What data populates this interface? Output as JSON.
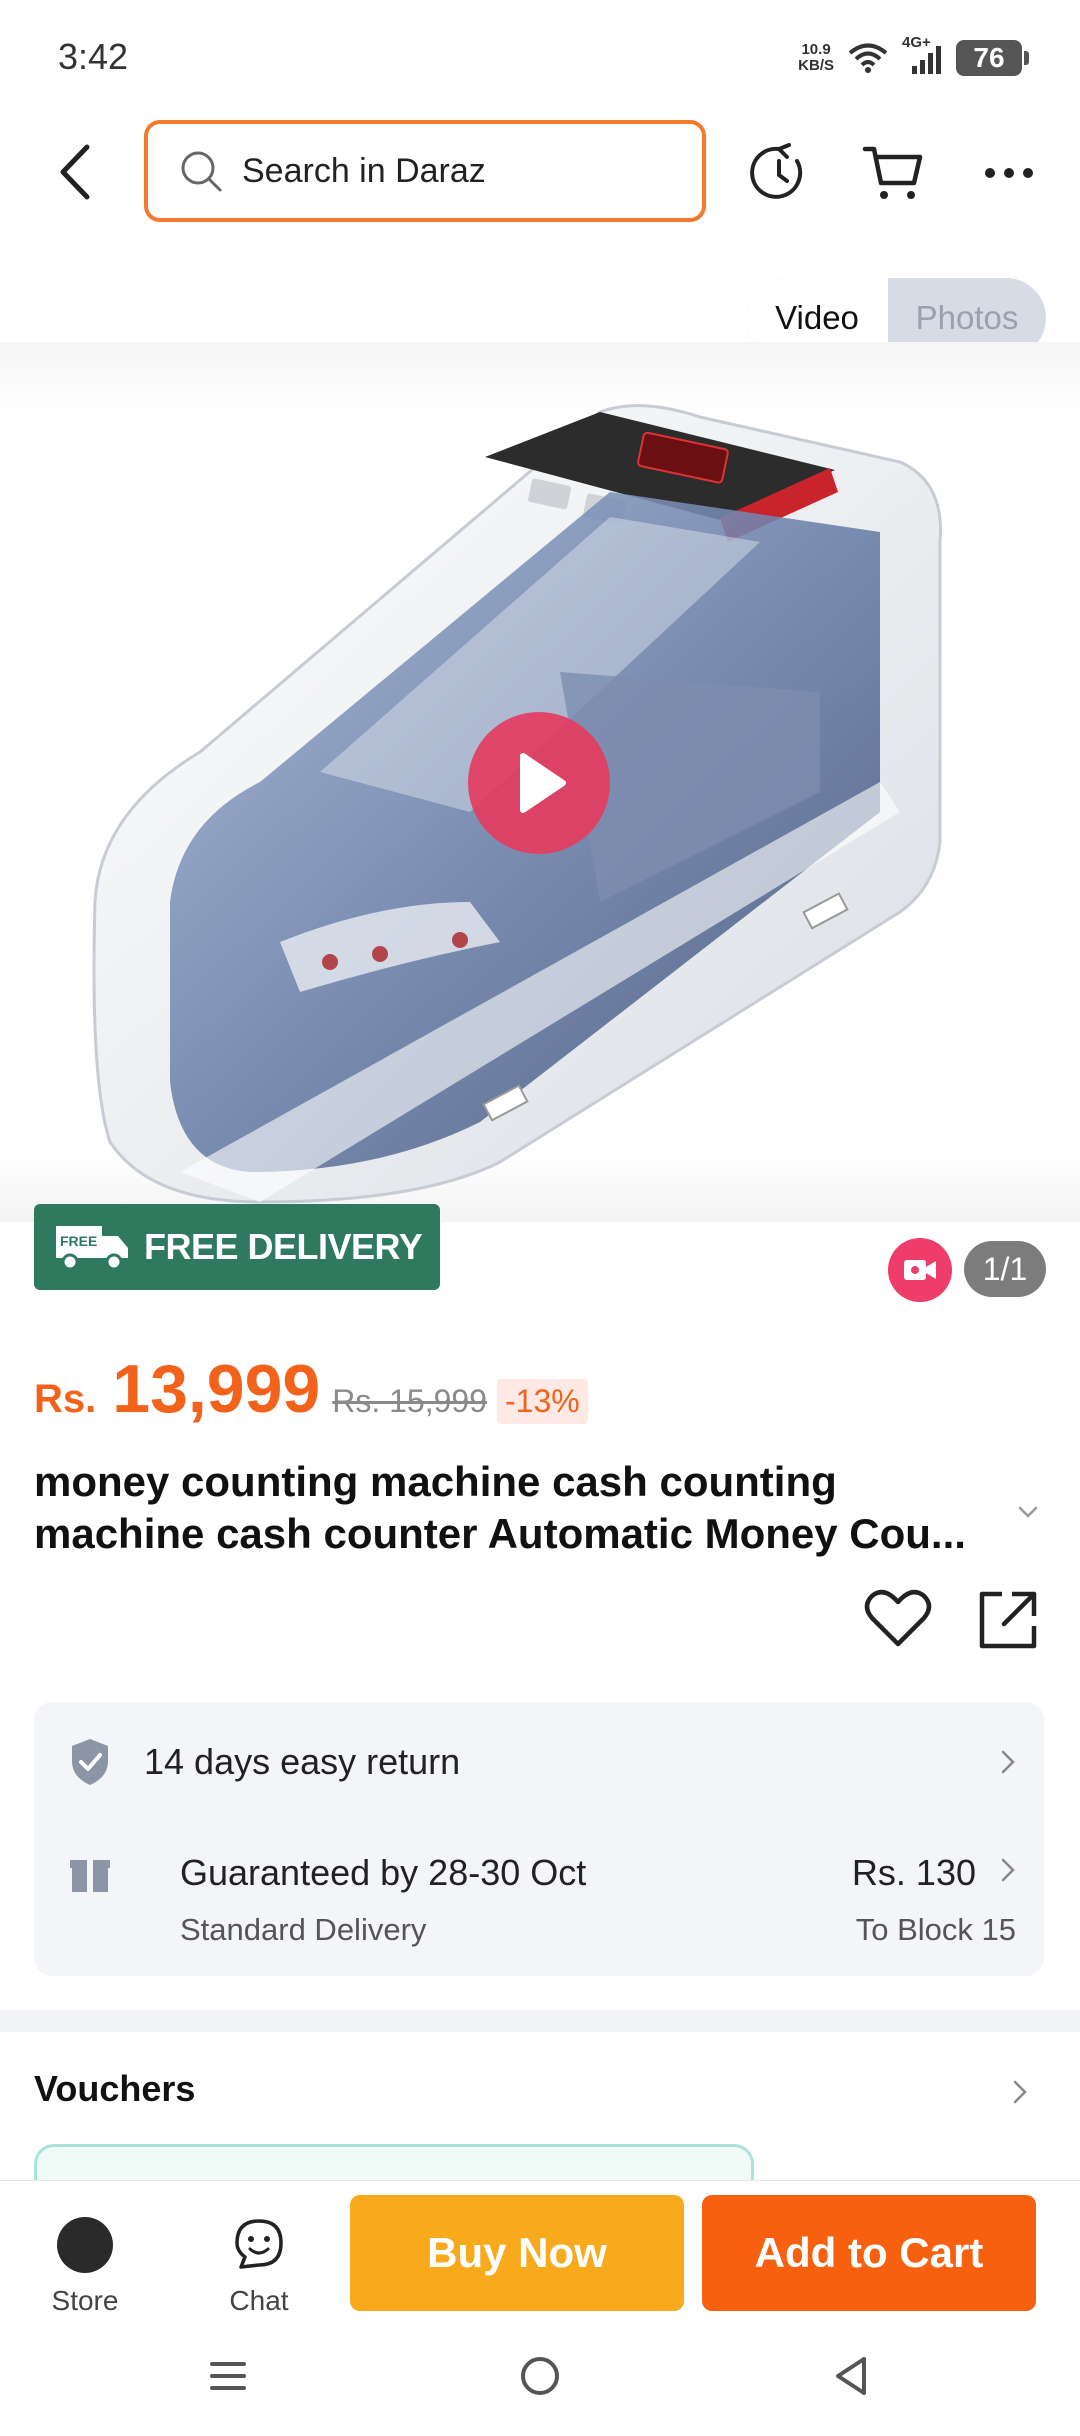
{
  "status_bar": {
    "time": "3:42",
    "net_speed_value": "10.9",
    "net_speed_unit": "KB/S",
    "network": "4G+",
    "battery": "76"
  },
  "header": {
    "search_placeholder": "Search in Daraz"
  },
  "media_toggle": {
    "video": "Video",
    "photos": "Photos",
    "active": "Video"
  },
  "gallery": {
    "badge_label": "FREE DELIVERY",
    "badge_tag": "FREE",
    "counter": "1/1"
  },
  "product": {
    "currency": "Rs.",
    "price": "13,999",
    "old_price": "Rs. 15,999",
    "discount": "-13%",
    "title_line1": "money counting machine cash counting",
    "title_line2": "machine cash counter Automatic Money Cou..."
  },
  "delivery": {
    "return_policy": "14 days easy return",
    "guarantee": "Guaranteed by 28-30 Oct",
    "method": "Standard Delivery",
    "fee": "Rs. 130",
    "destination": "To Block 15"
  },
  "vouchers": {
    "title": "Vouchers"
  },
  "action_bar": {
    "store_label": "Store",
    "chat_label": "Chat",
    "buy_now": "Buy Now",
    "add_to_cart": "Add to Cart"
  },
  "colors": {
    "brand_orange": "#f6600f",
    "buy_yellow": "#f9a91c",
    "badge_green": "#2f7a5e",
    "price_orange": "#f3621a"
  }
}
